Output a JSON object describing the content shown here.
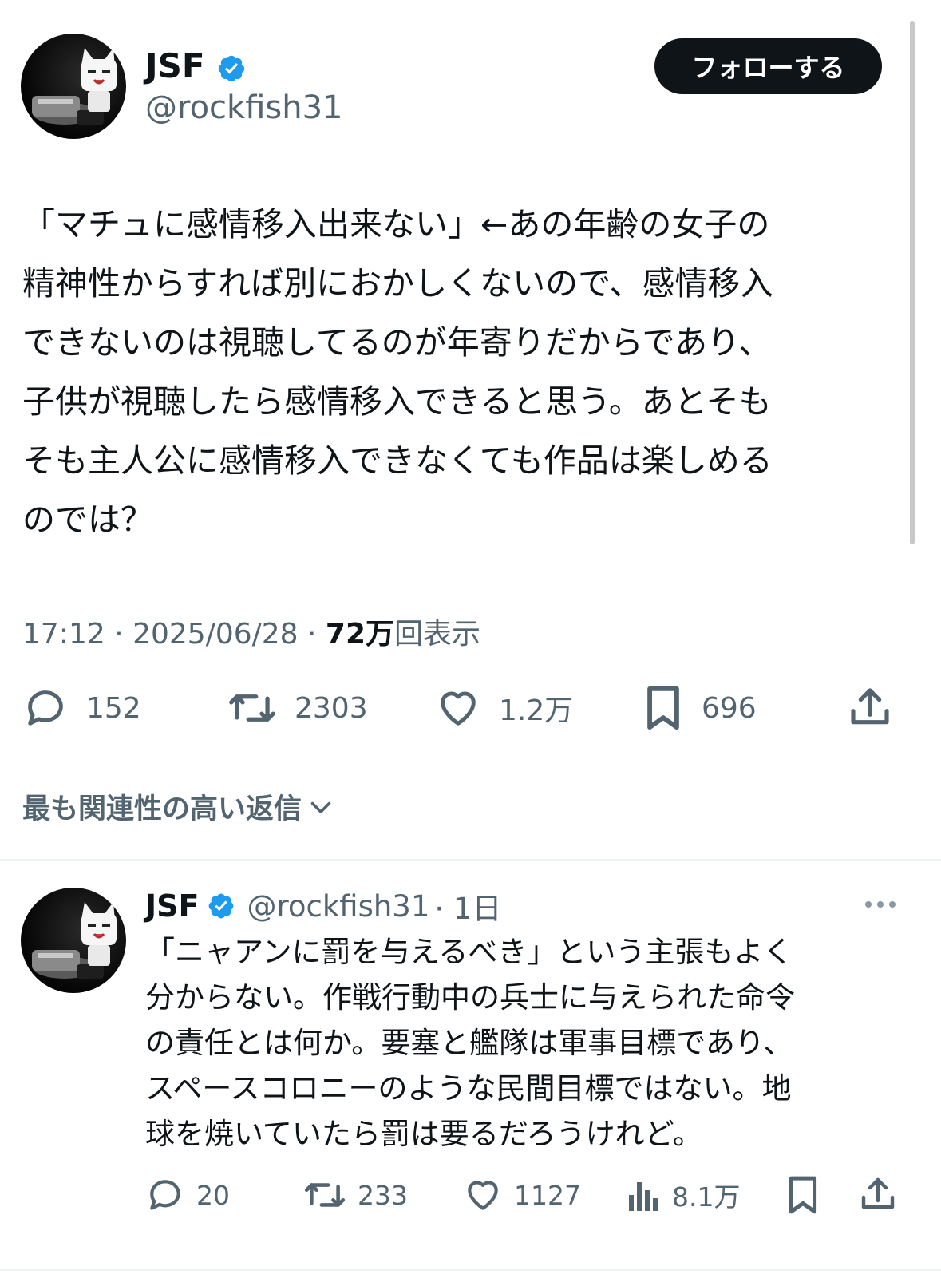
{
  "main_tweet": {
    "display_name": "JSF",
    "handle": "@rockfish31",
    "follow_label": "フォローする",
    "text": "「マチュに感情移入出来ない」←あの年齢の女子の\n精神性からすれば別におかしくないので、感情移入\nできないのは視聴してるのが年寄りだからであり、\n子供が視聴したら感情移入できると思う。あとそも\nそも主人公に感情移入できなくても作品は楽しめる\nのでは？",
    "time": "17:12 · 2025/06/28 · ",
    "views_count": "72万",
    "views_label": "回表示",
    "stats": {
      "replies": "152",
      "retweets": "2303",
      "likes": "1.2万",
      "bookmarks": "696"
    }
  },
  "replies_sort_label": "最も関連性の高い返信",
  "reply_tweet": {
    "display_name": "JSF",
    "handle": "@rockfish31",
    "age": "· 1日",
    "text": "「ニャアンに罰を与えるべき」という主張もよく\n分からない。作戦行動中の兵士に与えられた命令\nの責任とは何か。要塞と艦隊は軍事目標であり、\nスペースコロニーのような民間目標ではない。地\n球を焼いていたら罰は要るだろうけれど。",
    "stats": {
      "replies": "20",
      "retweets": "233",
      "likes": "1127",
      "views": "8.1万"
    }
  },
  "colors": {
    "text": "#0f1419",
    "secondary": "#536471",
    "verified": "#1d9bf0",
    "divider": "#eff3f4"
  },
  "icons": [
    "verified-badge-icon",
    "reply-icon",
    "retweet-icon",
    "like-icon",
    "bookmark-icon",
    "share-icon",
    "views-icon",
    "more-icon",
    "chevron-down-icon"
  ]
}
